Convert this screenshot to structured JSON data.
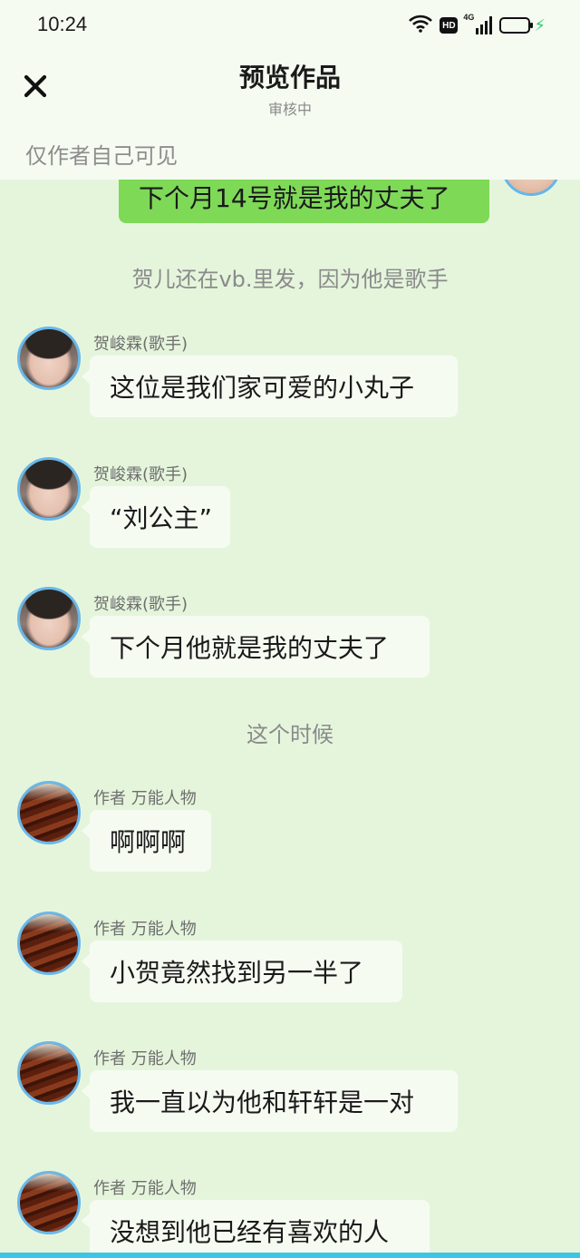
{
  "status_bar": {
    "time": "10:24",
    "icons": [
      "wifi-icon",
      "hd-icon",
      "signal-4g-icon",
      "battery-icon",
      "charging-icon"
    ],
    "hd_label": "HD",
    "network_label": "4G"
  },
  "header": {
    "title": "预览作品",
    "subtitle": "审核中",
    "close_icon": "close-icon",
    "visibility_note": "仅作者自己可见"
  },
  "chat": {
    "right_message": "下个月14号就是我的丈夫了",
    "narration_1": "贺儿还在vb.里发，因为他是歌手",
    "narration_2": "这个时候",
    "messages": [
      {
        "sender": "贺峻霖(歌手)",
        "text": "这位是我们家可爱的小丸子",
        "avatar": "singer-avatar"
      },
      {
        "sender": "贺峻霖(歌手)",
        "text": "“刘公主”",
        "avatar": "singer-avatar"
      },
      {
        "sender": "贺峻霖(歌手)",
        "text": "下个月他就是我的丈夫了",
        "avatar": "singer-avatar"
      },
      {
        "sender": "作者 万能人物",
        "text": "啊啊啊",
        "avatar": "food-avatar"
      },
      {
        "sender": "作者 万能人物",
        "text": "小贺竟然找到另一半了",
        "avatar": "food-avatar"
      },
      {
        "sender": "作者 万能人物",
        "text": "我一直以为他和轩轩是一对",
        "avatar": "food-avatar"
      },
      {
        "sender": "作者 万能人物",
        "text": "没想到他已经有喜欢的人",
        "avatar": "food-avatar"
      }
    ]
  },
  "colors": {
    "chat_background": "#e5f5dc",
    "header_background": "#f5fbf1",
    "right_bubble": "#7ed957",
    "left_bubble": "#f6fbf2",
    "avatar_ring": "#6ab8ea"
  }
}
